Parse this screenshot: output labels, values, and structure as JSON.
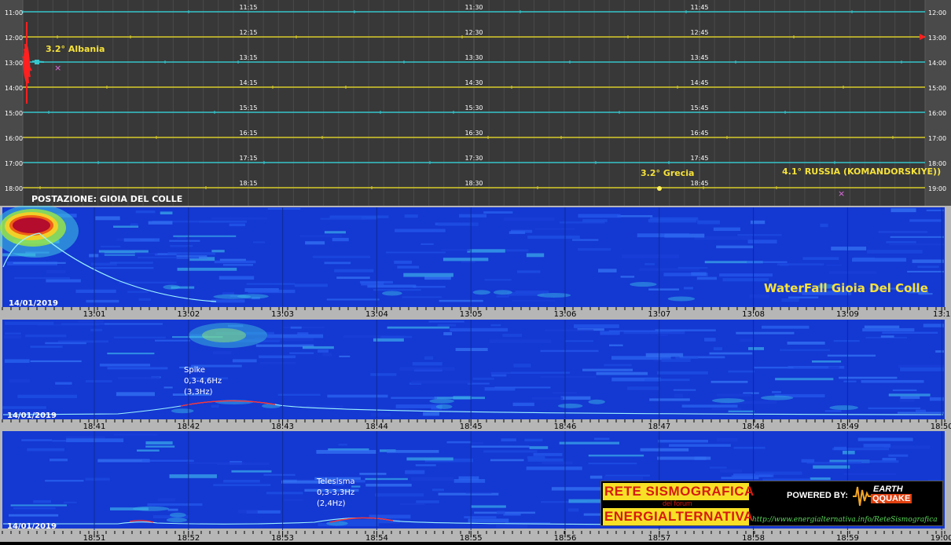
{
  "seismogram": {
    "station_label": "POSTAZIONE: GIOIA DEL COLLE",
    "left_hours": [
      "11:00",
      "12:00",
      "13:00",
      "14:00",
      "15:00",
      "16:00",
      "17:00",
      "18:00"
    ],
    "right_hours": [
      "12:00",
      "13:00",
      "14:00",
      "15:00",
      "16:00",
      "17:00",
      "18:00",
      "19:00"
    ],
    "col_labels": [
      [
        "11:15",
        "11:30",
        "11:45"
      ],
      [
        "12:15",
        "12:30",
        "12:45"
      ],
      [
        "13:15",
        "13:30",
        "13:45"
      ],
      [
        "14:15",
        "14:30",
        "14:45"
      ],
      [
        "15:15",
        "15:30",
        "15:45"
      ],
      [
        "16:15",
        "16:30",
        "16:45"
      ],
      [
        "17:15",
        "17:30",
        "17:45"
      ],
      [
        "18:15",
        "18:30",
        "18:45"
      ]
    ],
    "trace_colors": [
      "#35c6cc",
      "#d8cc2a"
    ],
    "events": [
      {
        "label": "3.2° Albania"
      },
      {
        "label": "3.2° Grecia"
      },
      {
        "label": "4.1° RUSSIA (KOMANDORSKIYE))"
      }
    ]
  },
  "waterfalls": [
    {
      "date": "14/01/2019",
      "title": "WaterFall Gioia Del Colle",
      "ticks": [
        "13:01",
        "13:02",
        "13:03",
        "13:04",
        "13:05",
        "13:06",
        "13:07",
        "13:08",
        "13:09",
        "13:1"
      ]
    },
    {
      "date": "14/01/2019",
      "ticks": [
        "18:41",
        "18:42",
        "18:43",
        "18:44",
        "18:45",
        "18:46",
        "18:47",
        "18:48",
        "18:49",
        "18:50"
      ],
      "annotation": [
        "Spike",
        "0,3-4,6Hz",
        "(3,3Hz)"
      ]
    },
    {
      "date": "14/01/2019",
      "ticks": [
        "18:51",
        "18:52",
        "18:53",
        "18:54",
        "18:55",
        "18:56",
        "18:57",
        "18:58",
        "18:59",
        "19:00"
      ],
      "annotation": [
        "Telesisma",
        "0,3-3,3Hz",
        "(2,4Hz)"
      ]
    }
  ],
  "logo": {
    "title": "RETE SISMOGRAFICA",
    "subtitle": "del forum",
    "brand": "ENERGIALTERNATIVA",
    "powered": "POWERED BY:",
    "partner_top": "EARTH",
    "partner_bottom": "QQUAKE",
    "url": "http://www.energialternativa.info/ReteSismografica"
  }
}
